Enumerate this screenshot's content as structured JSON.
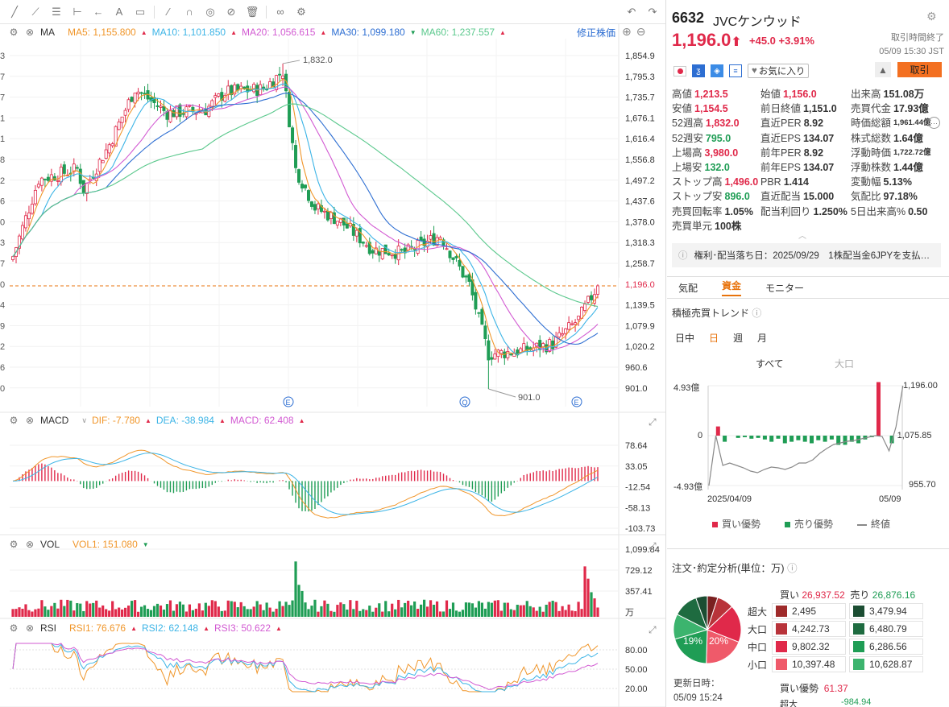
{
  "toolbar_icons": [
    "trendline-icon",
    "path-icon",
    "fib-icon",
    "ruler-icon",
    "arrow-icon",
    "text-icon",
    "note-icon",
    "pen-icon",
    "magnet-icon",
    "eye-icon",
    "clear-icon",
    "trash-icon",
    "link-icon",
    "settings-icon"
  ],
  "ma": {
    "name": "MA",
    "ma5": "MA5: 1,155.800",
    "ma10": "MA10: 1,101.850",
    "ma20": "MA20: 1,056.615",
    "ma30": "MA30: 1,099.180",
    "ma60": "MA60: 1,237.557",
    "adjust": "修正株価"
  },
  "price_axis": [
    "1,854.9",
    "1,795.3",
    "1,735.7",
    "1,676.1",
    "1,616.4",
    "1,556.8",
    "1,497.2",
    "1,437.6",
    "1,378.0",
    "1,318.3",
    "1,258.7",
    "1,196.0",
    "1,139.5",
    "1,079.9",
    "1,020.2",
    "960.6",
    "901.0"
  ],
  "left_axis_partial": [
    "3",
    "7",
    "7",
    "1",
    "1",
    "8",
    "2",
    "6",
    "0",
    "3",
    "7",
    "0",
    "4",
    "9",
    "2",
    "6",
    "0"
  ],
  "hi_label": "1,832.0",
  "lo_label": "901.0",
  "last_price_tag": "1,196.0",
  "event_marks": [
    "E",
    "Q",
    "E"
  ],
  "macd": {
    "name": "MACD",
    "dif": "DIF: -7.780",
    "dea": "DEA: -38.984",
    "macd": "MACD: 62.408",
    "axis": [
      "78.64",
      "33.05",
      "-12.54",
      "-58.13",
      "-103.73"
    ]
  },
  "vol": {
    "name": "VOL",
    "vol1": "VOL1: 151.080",
    "axis": [
      "1,099.84",
      "729.12",
      "357.41"
    ],
    "unit": "万"
  },
  "rsi": {
    "name": "RSI",
    "rsi1": "RSI1: 76.676",
    "rsi2": "RSI2: 62.148",
    "rsi3": "RSI3: 50.622",
    "axis": [
      "80.00",
      "50.00",
      "20.00"
    ]
  },
  "stock": {
    "code": "6632",
    "name": "JVCケンウッド",
    "price": "1,196.0",
    "change": "+45.0",
    "pct": "+3.91%",
    "status": "取引時間終了",
    "time": "05/09 15:30 JST",
    "fav": "お気に入り",
    "trade": "取引"
  },
  "quote": [
    [
      [
        "高値",
        "1,213.5",
        "up"
      ],
      [
        "始値",
        "1,156.0",
        "up"
      ],
      [
        "出来高",
        "151.08万",
        ""
      ]
    ],
    [
      [
        "安値",
        "1,154.5",
        "up"
      ],
      [
        "前日終値",
        "1,151.0",
        ""
      ],
      [
        "売買代金",
        "17.93億",
        ""
      ]
    ],
    [
      [
        "52週高",
        "1,832.0",
        "up"
      ],
      [
        "直近PER",
        "8.92",
        ""
      ],
      [
        "時価総額",
        "1,961.44億",
        ""
      ]
    ],
    [
      [
        "52週安",
        "795.0",
        "dn"
      ],
      [
        "直近EPS",
        "134.07",
        ""
      ],
      [
        "株式総数",
        "1.64億",
        ""
      ]
    ],
    [
      [
        "上場高",
        "3,980.0",
        "up"
      ],
      [
        "前年PER",
        "8.92",
        ""
      ],
      [
        "浮動時価",
        "1,722.72億",
        ""
      ]
    ],
    [
      [
        "上場安",
        "132.0",
        "dn"
      ],
      [
        "前年EPS",
        "134.07",
        ""
      ],
      [
        "浮動株数",
        "1.44億",
        ""
      ]
    ],
    [
      [
        "ストップ高",
        "1,496.0",
        "up"
      ],
      [
        "PBR",
        "1.414",
        ""
      ],
      [
        "変動幅",
        "5.13%",
        ""
      ]
    ],
    [
      [
        "ストップ安",
        "896.0",
        "dn"
      ],
      [
        "直近配当",
        "15.000",
        ""
      ],
      [
        "気配比",
        "97.18%",
        ""
      ]
    ],
    [
      [
        "売買回転率",
        "1.05%",
        ""
      ],
      [
        "配当利回り",
        "1.250%",
        ""
      ],
      [
        "5日出来高%",
        "0.50",
        ""
      ]
    ],
    [
      [
        "売買単元",
        "100株",
        ""
      ]
    ]
  ],
  "dividend": "権利･配当落ち日：2025/09/29　1株配当金6JPYを支払…",
  "tabs": [
    "気配",
    "資金",
    "モニター"
  ],
  "trend": {
    "title": "積極売買トレンド",
    "periods": [
      "日中",
      "日",
      "週",
      "月"
    ],
    "scopes": [
      "すべて",
      "大口"
    ],
    "yl": [
      "4.93億",
      "0",
      "-4.93億"
    ],
    "yr": [
      "1,196.00",
      "-1,075.85",
      "955.70"
    ],
    "xl": "2025/04/09",
    "xr": "05/09",
    "legend": [
      "買い優勢",
      "売り優勢",
      "終値"
    ]
  },
  "order": {
    "title": "注文･約定分析(単位：万)",
    "buy_label": "買い",
    "buy_total": "26,937.52",
    "sell_label": "売り",
    "sell_total": "26,876.16",
    "rows": [
      [
        "超大",
        "2,495",
        "3,479.94"
      ],
      [
        "大口",
        "4,242.73",
        "6,480.79"
      ],
      [
        "中口",
        "9,802.32",
        "6,286.56"
      ],
      [
        "小口",
        "10,397.48",
        "10,628.87"
      ]
    ],
    "pie_l": "19%",
    "pie_r": "20%",
    "updated_label": "更新日時：",
    "updated": "05/09 15:24",
    "dom_label": "買い優勢",
    "dom_value": "61.37",
    "bottom_value": "-984.94",
    "bottom_label": "超大"
  },
  "colors": {
    "up": "#e0294a",
    "dn": "#1f9d55",
    "ma5": "#f0962a",
    "ma10": "#3cb4e6",
    "ma20": "#d25ad2",
    "ma30": "#2d6ed2",
    "ma60": "#5ac88c"
  },
  "chart_data": {
    "type": "candlestick",
    "range": {
      "high": 1832.0,
      "low": 901.0,
      "last": 1196.0
    },
    "macd": {
      "dif": -7.78,
      "dea": -38.984,
      "hist": 62.408
    },
    "volume_last": 151.08,
    "rsi": [
      76.676,
      62.148,
      50.622
    ]
  }
}
